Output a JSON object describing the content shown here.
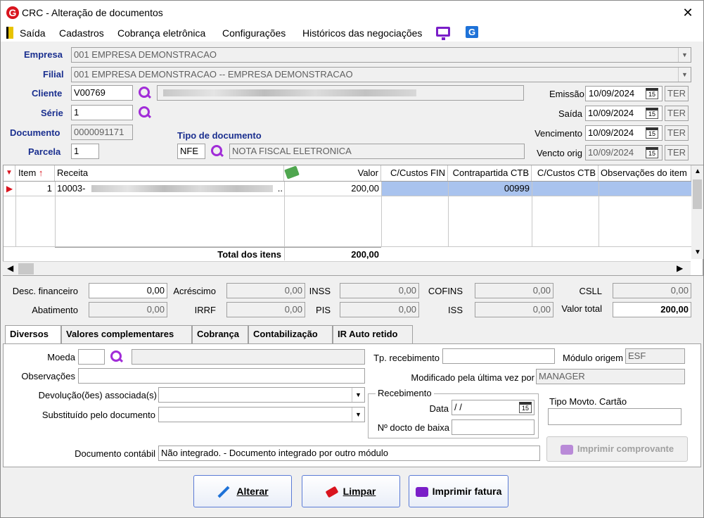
{
  "window": {
    "title": "CRC - Alteração de documentos",
    "close": "✕"
  },
  "menu": {
    "items": [
      "Saída",
      "Cadastros",
      "Cobrança eletrônica",
      "Configurações",
      "Históricos das negociações"
    ]
  },
  "form": {
    "empresa_label": "Empresa",
    "empresa_value": "001 EMPRESA DEMONSTRACAO",
    "filial_label": "Filial",
    "filial_value": "001 EMPRESA DEMONSTRACAO -- EMPRESA DEMONSTRACAO",
    "cliente_label": "Cliente",
    "cliente_value": "V00769",
    "serie_label": "Série",
    "serie_value": "1",
    "documento_label": "Documento",
    "documento_value": "0000091171",
    "parcela_label": "Parcela",
    "parcela_value": "1",
    "tipo_doc_label": "Tipo de documento",
    "tipo_doc_code": "NFE",
    "tipo_doc_desc": "NOTA FISCAL ELETRONICA",
    "emissao_label": "Emissão",
    "emissao_value": "10/09/2024",
    "emissao_day": "TER",
    "saida_label": "Saída",
    "saida_value": "10/09/2024",
    "saida_day": "TER",
    "vencimento_label": "Vencimento",
    "vencimento_value": "10/09/2024",
    "vencimento_day": "TER",
    "vencto_orig_label": "Vencto orig",
    "vencto_orig_value": "10/09/2024",
    "vencto_orig_day": "TER",
    "cal_icon_text": "15"
  },
  "grid": {
    "headers": [
      "Item",
      "Receita",
      "Valor",
      "C/Custos FIN",
      "Contrapartida CTB",
      "C/Custos CTB",
      "Observações do item"
    ],
    "rows": [
      {
        "item": "1",
        "receita": "10003-",
        "receita_suffix": "..",
        "valor": "200,00",
        "ccustos_fin": "",
        "contrapartida": "00999",
        "ccustos_ctb": "",
        "obs": ""
      }
    ],
    "total_label": "Total dos itens",
    "total_value": "200,00"
  },
  "totals": {
    "desc_fin_label": "Desc. financeiro",
    "desc_fin": "0,00",
    "acrescimo_label": "Acréscimo",
    "acrescimo": "0,00",
    "inss_label": "INSS",
    "inss": "0,00",
    "cofins_label": "COFINS",
    "cofins": "0,00",
    "csll_label": "CSLL",
    "csll": "0,00",
    "abatimento_label": "Abatimento",
    "abatimento": "0,00",
    "irrf_label": "IRRF",
    "irrf": "0,00",
    "pis_label": "PIS",
    "pis": "0,00",
    "iss_label": "ISS",
    "iss": "0,00",
    "valor_total_label": "Valor total",
    "valor_total": "200,00"
  },
  "tabs": [
    "Diversos",
    "Valores complementares",
    "Cobrança",
    "Contabilização",
    "IR Auto retido"
  ],
  "diversos": {
    "moeda_label": "Moeda",
    "obs_label": "Observações",
    "devolucao_label": "Devolução(ões) associada(s)",
    "substituido_label": "Substituído pelo documento",
    "doc_contabil_label": "Documento contábil",
    "doc_contabil_value": "Não integrado.  - Documento integrado por outro módulo",
    "tp_receb_label": "Tp. recebimento",
    "modulo_origem_label": "Módulo origem",
    "modulo_origem_value": "ESF",
    "modificado_label": "Modificado pela última vez por",
    "modificado_value": "MANAGER",
    "recebimento_group": "Recebimento",
    "data_label": "Data",
    "data_value": " /  /",
    "ndocto_label": "Nº docto de baixa",
    "tipo_movto_label": "Tipo Movto. Cartão",
    "imprimir_comprovante": "Imprimir comprovante"
  },
  "buttons": {
    "alterar": "Alterar",
    "limpar": "Limpar",
    "imprimir_fatura": "Imprimir fatura"
  }
}
